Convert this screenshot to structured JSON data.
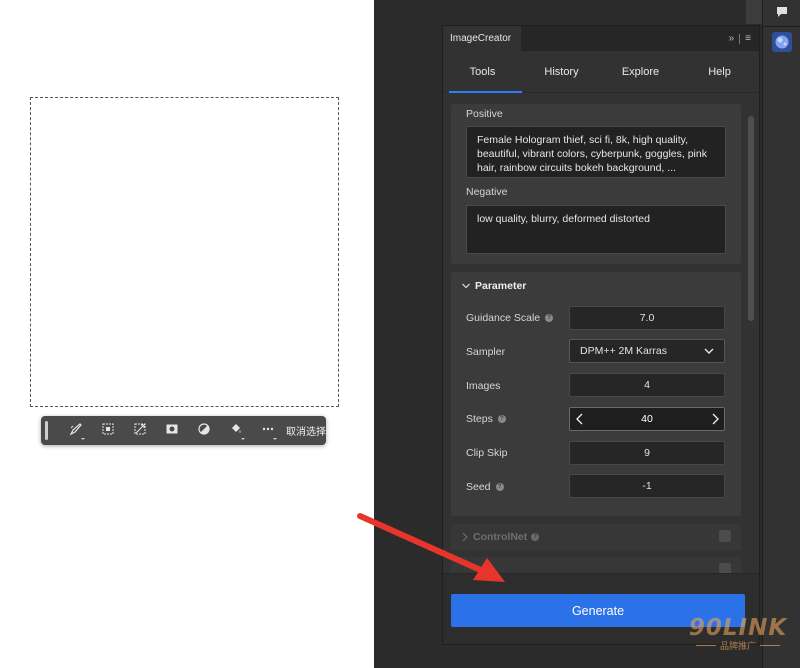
{
  "toolbar": {
    "clear_selection_label": "取消选择",
    "buttons": [
      {
        "icon": "brush-selection-icon"
      },
      {
        "icon": "selection-grid-icon"
      },
      {
        "icon": "transform-icon"
      },
      {
        "icon": "mask-icon"
      },
      {
        "icon": "invert-icon"
      },
      {
        "icon": "fill-bucket-icon"
      },
      {
        "icon": "more-options-icon"
      }
    ]
  },
  "panel": {
    "title": "ImageCreator",
    "header_controls": {
      "expand": "»",
      "menu": "≡"
    },
    "nav_tabs": [
      {
        "label": "Tools",
        "active": true
      },
      {
        "label": "History",
        "active": false
      },
      {
        "label": "Explore",
        "active": false
      },
      {
        "label": "Help",
        "active": false
      }
    ],
    "prompts": {
      "positive_label": "Positive",
      "positive_value": "Female Hologram thief, sci fi, 8k, high quality, beautiful, vibrant colors, cyberpunk, goggles, pink hair, rainbow circuits bokeh background, ...",
      "negative_label": "Negative",
      "negative_value": "low quality, blurry, deformed distorted"
    },
    "parameter": {
      "title": "Parameter",
      "guidance_scale": {
        "label": "Guidance Scale",
        "value": "7.0"
      },
      "sampler": {
        "label": "Sampler",
        "value": "DPM++ 2M Karras"
      },
      "images": {
        "label": "Images",
        "value": "4"
      },
      "steps": {
        "label": "Steps",
        "value": "40"
      },
      "clip_skip": {
        "label": "Clip Skip",
        "value": "9"
      },
      "seed": {
        "label": "Seed",
        "value": "-1"
      }
    },
    "controlnet": {
      "title": "ControlNet"
    },
    "generate_label": "Generate"
  },
  "watermark": {
    "logo": "90LINK",
    "sub": "品牌推广"
  },
  "colors": {
    "accent": "#2b72e8",
    "tab_underline": "#2d7ff9",
    "annotation_arrow": "#e8352c"
  }
}
